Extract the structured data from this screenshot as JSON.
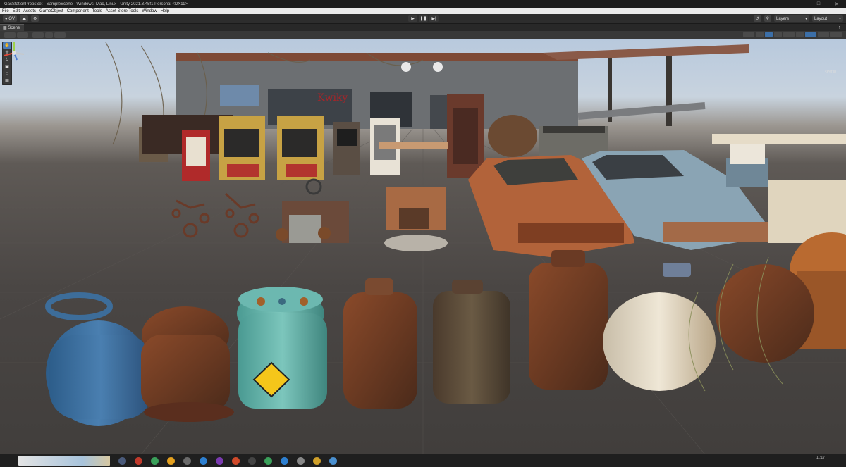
{
  "window": {
    "title": "GasStationPropsSet - SampleScene - Windows, Mac, Linux - Unity 2021.3.45f1 Personal <DX11>",
    "minimize_icon": "minimize-icon",
    "maximize_icon": "maximize-icon",
    "close_icon": "close-icon"
  },
  "menubar": {
    "items": [
      "File",
      "Edit",
      "Assets",
      "GameObject",
      "Component",
      "Tools",
      "Asset Store Tools",
      "Window",
      "Help"
    ]
  },
  "toolbar": {
    "account_label": "OV",
    "play_icon": "play-icon",
    "pause_icon": "pause-icon",
    "step_icon": "step-icon",
    "layers_label": "Layers",
    "layout_label": "Layout"
  },
  "scene_tab": {
    "label": "Scene"
  },
  "taskbar": {
    "time": "11:17",
    "date": "..."
  },
  "colors": {
    "accent": "#4d7bb5",
    "menubar_bg": "#ebebeb",
    "editor_dark": "#2d2d2d"
  }
}
